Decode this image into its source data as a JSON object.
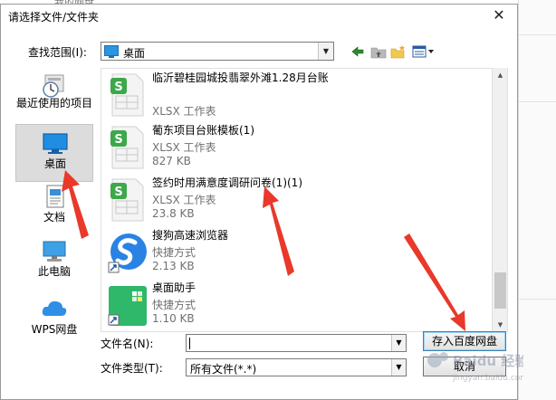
{
  "background_tab": {
    "label": "我的网盘"
  },
  "dialog": {
    "title": "请选择文件/文件夹",
    "close_symbol": "✕",
    "look_in": {
      "label": "查找范围(I):",
      "value": "桌面"
    }
  },
  "places": [
    {
      "label": "最近使用的项目",
      "icon": "recent-clock-icon",
      "selected": false
    },
    {
      "label": "桌面",
      "icon": "desktop-icon",
      "selected": true
    },
    {
      "label": "文档",
      "icon": "documents-icon",
      "selected": false
    },
    {
      "label": "此电脑",
      "icon": "computer-icon",
      "selected": false
    },
    {
      "label": "WPS网盘",
      "icon": "cloud-icon",
      "selected": false
    }
  ],
  "files": [
    {
      "name": "临沂碧桂园城投翡翠外滩1.28月台账",
      "type": "XLSX 工作表",
      "size": "",
      "icon": "wps-sheet-icon"
    },
    {
      "name": "葡东项目台账模板(1)",
      "type": "XLSX 工作表",
      "size": "827 KB",
      "icon": "wps-sheet-icon"
    },
    {
      "name": "签约时用满意度调研问卷(1)(1)",
      "type": "XLSX 工作表",
      "size": "23.8 KB",
      "icon": "wps-sheet-icon"
    },
    {
      "name": "搜狗高速浏览器",
      "type": "快捷方式",
      "size": "2.13 KB",
      "icon": "sogou-browser-icon"
    },
    {
      "name": "桌面助手",
      "type": "快捷方式",
      "size": "1.10 KB",
      "icon": "desktop-assistant-icon"
    }
  ],
  "file_name": {
    "label": "文件名(N):",
    "value": ""
  },
  "file_type": {
    "label": "文件类型(T):",
    "value": "所有文件(*.*)"
  },
  "buttons": {
    "save": "存入百度网盘",
    "cancel": "取消"
  },
  "watermark": {
    "brand": "Baidu 经验",
    "url": "jingyan.baidu.com"
  },
  "colors": {
    "annotation_arrow": "#e8392a",
    "wps_green": "#3ba84a",
    "selection": "#dcdcdc"
  }
}
